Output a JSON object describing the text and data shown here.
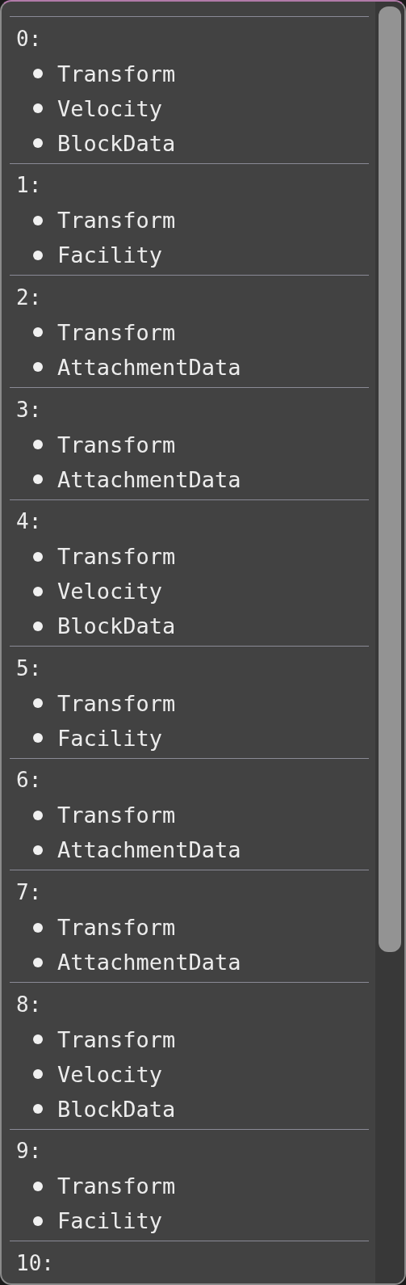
{
  "entities": [
    {
      "label": "0:",
      "components": [
        "Transform",
        "Velocity",
        "BlockData"
      ]
    },
    {
      "label": "1:",
      "components": [
        "Transform",
        "Facility"
      ]
    },
    {
      "label": "2:",
      "components": [
        "Transform",
        "AttachmentData"
      ]
    },
    {
      "label": "3:",
      "components": [
        "Transform",
        "AttachmentData"
      ]
    },
    {
      "label": "4:",
      "components": [
        "Transform",
        "Velocity",
        "BlockData"
      ]
    },
    {
      "label": "5:",
      "components": [
        "Transform",
        "Facility"
      ]
    },
    {
      "label": "6:",
      "components": [
        "Transform",
        "AttachmentData"
      ]
    },
    {
      "label": "7:",
      "components": [
        "Transform",
        "AttachmentData"
      ]
    },
    {
      "label": "8:",
      "components": [
        "Transform",
        "Velocity",
        "BlockData"
      ]
    },
    {
      "label": "9:",
      "components": [
        "Transform",
        "Facility"
      ]
    },
    {
      "label": "10:"
    }
  ]
}
